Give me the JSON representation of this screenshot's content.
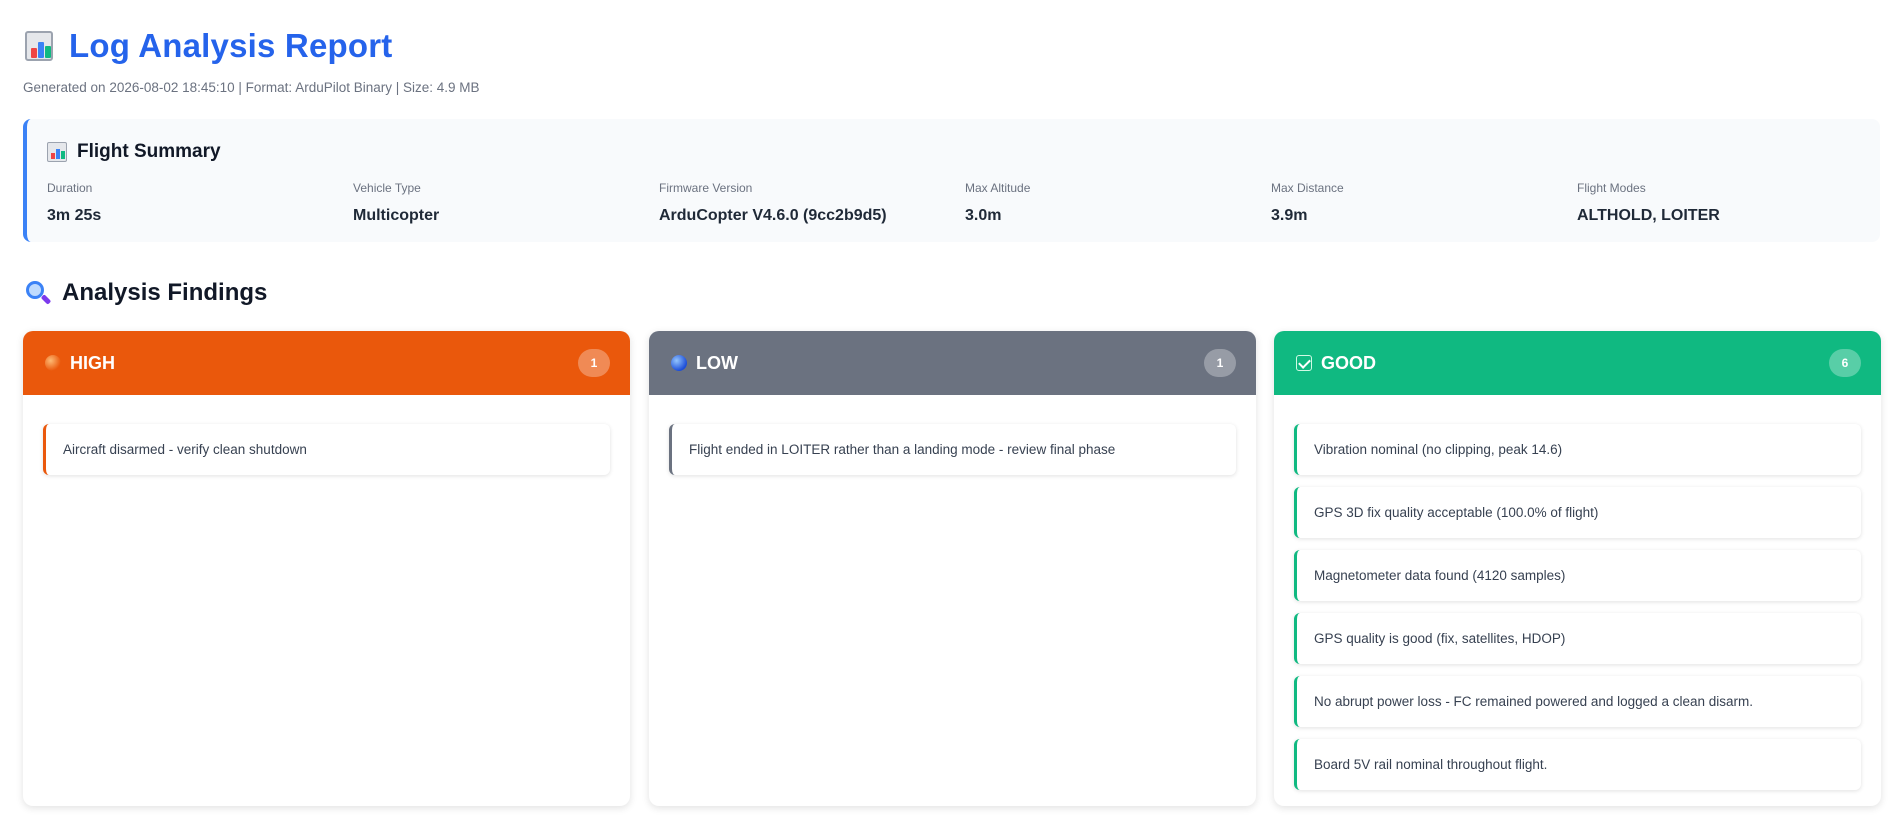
{
  "header": {
    "title": "Log Analysis Report",
    "subtitle": "Generated on 2026-08-02 18:45:10 | Format: ArduPilot Binary | Size: 4.9 MB",
    "title_color": "#2563eb",
    "icon": "bar-chart-icon"
  },
  "summary": {
    "title": "Flight Summary",
    "icon": "bar-chart-icon",
    "stats": [
      {
        "label": "Duration",
        "value": "3m 25s"
      },
      {
        "label": "Vehicle Type",
        "value": "Multicopter"
      },
      {
        "label": "Firmware Version",
        "value": "ArduCopter V4.6.0 (9cc2b9d5)"
      },
      {
        "label": "Max Altitude",
        "value": "3.0m"
      },
      {
        "label": "Max Distance",
        "value": "3.9m"
      },
      {
        "label": "Flight Modes",
        "value": "ALTHOLD, LOITER"
      }
    ]
  },
  "findings": {
    "title": "Analysis Findings",
    "icon": "magnifier-icon",
    "columns": [
      {
        "label": "HIGH",
        "count": "1",
        "color": "#ea580c",
        "icon": "orange-circle-icon",
        "items": [
          "Aircraft disarmed - verify clean shutdown"
        ]
      },
      {
        "label": "LOW",
        "count": "1",
        "color": "#6b7280",
        "icon": "blue-circle-icon",
        "items": [
          "Flight ended in LOITER rather than a landing mode - review final phase"
        ]
      },
      {
        "label": "GOOD",
        "count": "6",
        "color": "#10b981",
        "icon": "check-mark-icon",
        "items": [
          "Vibration nominal (no clipping, peak 14.6)",
          "GPS 3D fix quality acceptable (100.0% of flight)",
          "Magnetometer data found (4120 samples)",
          "GPS quality is good (fix, satellites, HDOP)",
          "No abrupt power loss - FC remained powered and logged a clean disarm.",
          "Board 5V rail nominal throughout flight."
        ]
      }
    ]
  }
}
